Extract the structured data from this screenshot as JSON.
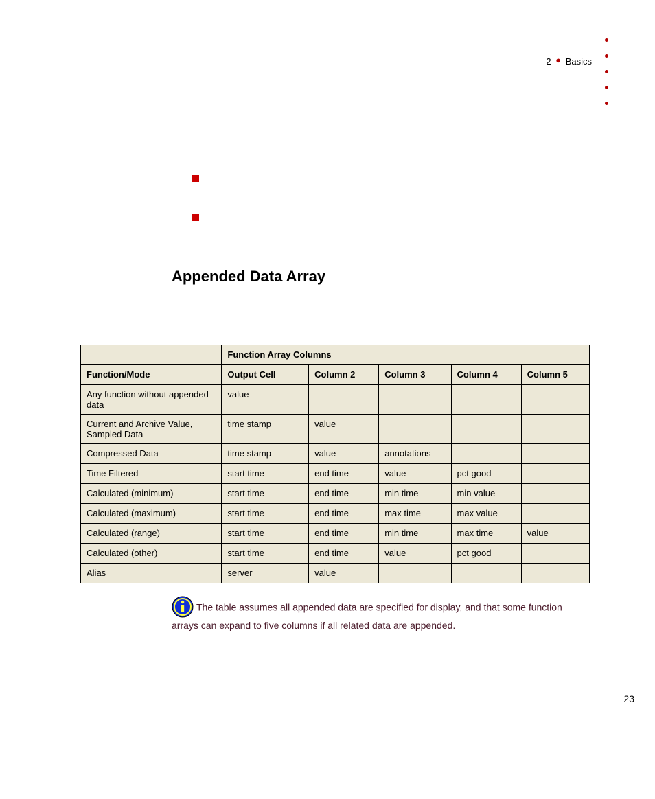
{
  "header": {
    "chapter_number": "2",
    "chapter_title": "Basics"
  },
  "section_title": "Appended Data Array",
  "table": {
    "super_header_empty": "",
    "super_header_span": "Function Array Columns",
    "headers": [
      "Function/Mode",
      "Output Cell",
      "Column 2",
      "Column 3",
      "Column 4",
      "Column 5"
    ],
    "rows": [
      [
        "Any function without appended data",
        "value",
        "",
        "",
        "",
        ""
      ],
      [
        "Current and Archive Value, Sampled Data",
        "time stamp",
        "value",
        "",
        "",
        ""
      ],
      [
        "Compressed Data",
        "time stamp",
        "value",
        "annotations",
        "",
        ""
      ],
      [
        "Time Filtered",
        "start time",
        "end time",
        "value",
        "pct good",
        ""
      ],
      [
        "Calculated (minimum)",
        "start time",
        "end time",
        "min time",
        "min value",
        ""
      ],
      [
        "Calculated (maximum)",
        "start time",
        "end time",
        "max time",
        "max value",
        ""
      ],
      [
        "Calculated (range)",
        "start time",
        "end time",
        "min time",
        "max time",
        "value"
      ],
      [
        "Calculated (other)",
        "start time",
        "end time",
        "value",
        "pct good",
        ""
      ],
      [
        "Alias",
        "server",
        "value",
        "",
        "",
        ""
      ]
    ]
  },
  "note_text": "The table assumes all appended data are specified for display, and that some function arrays can expand to five columns if all related data are appended.",
  "page_number": "23"
}
